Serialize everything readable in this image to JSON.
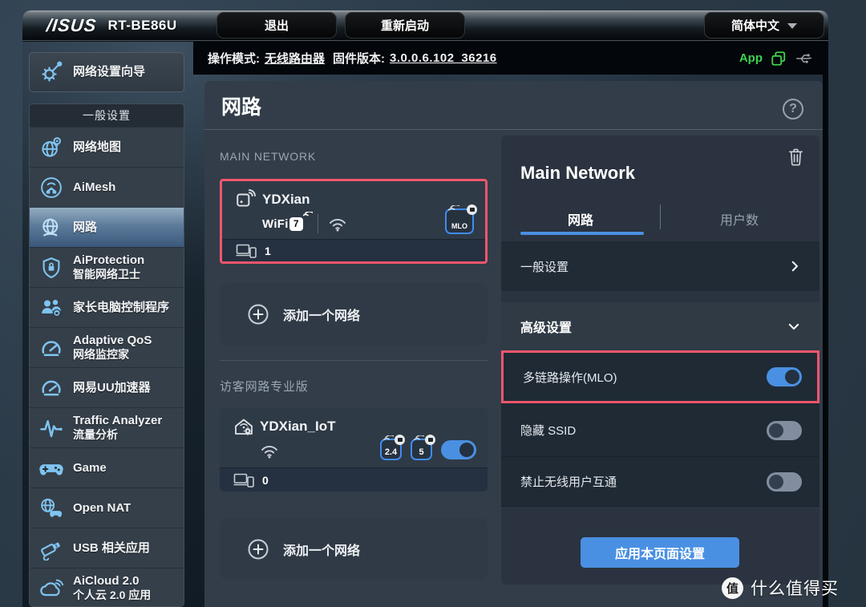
{
  "header": {
    "brand": "/ISUS",
    "model": "RT-BE86U",
    "logout": "退出",
    "reboot": "重新启动",
    "language": "简体中文"
  },
  "infobar": {
    "mode_label": "操作模式:",
    "mode_value": "无线路由器",
    "firmware_label": "固件版本:",
    "firmware_value": "3.0.0.6.102_36216",
    "app_label": "App"
  },
  "sidebar": {
    "wizard": "网络设置向导",
    "section": "一般设置",
    "items": [
      {
        "label": "网络地图",
        "sub": ""
      },
      {
        "label": "AiMesh",
        "sub": ""
      },
      {
        "label": "网路",
        "sub": ""
      },
      {
        "label": "AiProtection",
        "sub": "智能网络卫士"
      },
      {
        "label": "家长电脑控制程序",
        "sub": ""
      },
      {
        "label": "Adaptive QoS",
        "sub": "网络监控家"
      },
      {
        "label": "网易UU加速器",
        "sub": ""
      },
      {
        "label": "Traffic Analyzer",
        "sub": "流量分析"
      },
      {
        "label": "Game",
        "sub": ""
      },
      {
        "label": "Open NAT",
        "sub": ""
      },
      {
        "label": "USB 相关应用",
        "sub": ""
      },
      {
        "label": "AiCloud 2.0",
        "sub": "个人云 2.0 应用"
      }
    ]
  },
  "main": {
    "title": "网路",
    "help": "?",
    "main_section": "MAIN NETWORK",
    "guest_section": "访客网路专业版",
    "add_network": "添加一个网络",
    "main_card": {
      "ssid": "YDXian",
      "wifi_gen": "WiFi",
      "wifi_gen_num": "7",
      "mlo_badge": "MLO",
      "clients": "1"
    },
    "guest_card": {
      "ssid": "YDXian_IoT",
      "band_24": "2.4",
      "band_5": "5",
      "clients": "0"
    }
  },
  "detail": {
    "title": "Main Network",
    "tab_network": "网路",
    "tab_users": "用户数",
    "row_general": "一般设置",
    "row_advanced": "高级设置",
    "row_mlo": "多链路操作(MLO)",
    "row_hide_ssid": "隐藏 SSID",
    "row_isolation": "禁止无线用户互通",
    "apply": "应用本页面设置",
    "toggle_mlo": "on",
    "toggle_hide_ssid": "off",
    "toggle_isolation": "off",
    "guest_toggle": "on"
  },
  "watermark": {
    "badge": "值",
    "text": "什么值得买"
  },
  "colors": {
    "accent": "#4a90e2",
    "annotation": "#f0566c",
    "app_green": "#3ed24e",
    "icon_blue": "#7fc4f0"
  }
}
